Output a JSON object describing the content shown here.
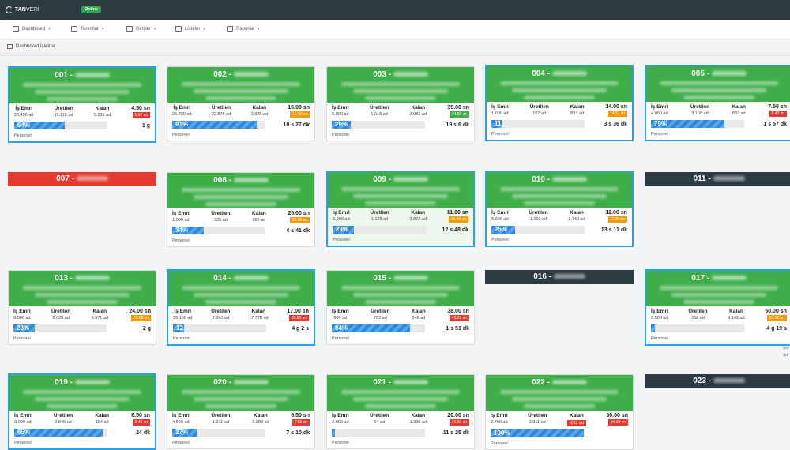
{
  "header": {
    "logo_text": "TANVERİ",
    "logo_bold": "TAN",
    "logo_light": "VERİ",
    "status": "Online"
  },
  "menu": [
    {
      "label": "Dashboard",
      "icon": "dashboard-icon"
    },
    {
      "label": "Tanımlar",
      "icon": "definitions-icon"
    },
    {
      "label": "Girişler",
      "icon": "entries-icon"
    },
    {
      "label": "Listeler",
      "icon": "lists-icon"
    },
    {
      "label": "Raporlar",
      "icon": "reports-icon"
    }
  ],
  "breadcrumb": "Dashboard İşletme",
  "labels": {
    "order": "İş Emri",
    "produced": "Üretilen",
    "remaining": "Kalan",
    "staff": "Personel"
  },
  "colors": {
    "green": "#3fae49",
    "red": "#e53a2f",
    "orange": "#f59b00",
    "dark": "#2e3a42",
    "selected": "#2aa1e3",
    "progress": "#2e86de"
  },
  "cards": [
    {
      "id": "001",
      "order": "20.450 ad",
      "produced": "11.115 ad",
      "remaining": "9.335 ad",
      "cycle": "4.50 sn",
      "badge": "5.57 sn",
      "badge_color": "red",
      "progress": 54,
      "progress_label": "54%",
      "time": "1 g",
      "selected": true
    },
    {
      "id": "002",
      "order": "25.200 ad",
      "produced": "22.875 ad",
      "remaining": "2.325 ad",
      "cycle": "15.00 sn",
      "badge": "16.19 sn",
      "badge_color": "orange",
      "progress": 91,
      "progress_label": "91%",
      "time": "10 s 27 dk"
    },
    {
      "id": "003",
      "order": "5.000 ad",
      "produced": "1.018 ad",
      "remaining": "3.982 ad",
      "cycle": "35.00 sn",
      "badge": "34.56 sn",
      "badge_color": "green",
      "progress": 20,
      "progress_label": "20%",
      "time": "19 s 6 dk"
    },
    {
      "id": "004",
      "order": "1.000 ad",
      "produced": "107 ad",
      "remaining": "893 ad",
      "cycle": "14.00 sn",
      "badge": "14.57 sn",
      "badge_color": "orange",
      "progress": 11,
      "progress_label": "11",
      "time": "3 s 36 dk",
      "selected": true
    },
    {
      "id": "005",
      "order": "4.000 ad",
      "produced": "3.168 ad",
      "remaining": "832 ad",
      "cycle": "7.50 sn",
      "badge": "8.43 sn",
      "badge_color": "red",
      "progress": 79,
      "progress_label": "79%",
      "time": "1 s 57 dk",
      "selected": true
    },
    {
      "id": "008",
      "order": "1.000 ad",
      "produced": "335 ad",
      "remaining": "665 ad",
      "cycle": "25.00 sn",
      "badge": "29.36 sn",
      "badge_color": "orange",
      "progress": 34,
      "progress_label": "34%",
      "time": "4 s 41 dk"
    },
    {
      "id": "009",
      "order": "5.000 ad",
      "produced": "1.128 ad",
      "remaining": "3.872 ad",
      "cycle": "11.00 sn",
      "badge": "11.80 sn",
      "badge_color": "orange",
      "progress": 23,
      "progress_label": "23%",
      "time": "12 s 48 dk",
      "selected": true,
      "soft": true
    },
    {
      "id": "010",
      "order": "5.000 ad",
      "produced": "1.260 ad",
      "remaining": "3.740 ad",
      "cycle": "12.00 sn",
      "badge": "12.96 sn",
      "badge_color": "orange",
      "progress": 25,
      "progress_label": "25%",
      "time": "13 s 11 dk",
      "selected": true
    },
    {
      "id": "013",
      "order": "9.000 ad",
      "produced": "2.029 ad",
      "remaining": "6.971 ad",
      "cycle": "24.00 sn",
      "badge": "25.08 sn",
      "badge_color": "orange",
      "progress": 23,
      "progress_label": "23%",
      "time": "2 g"
    },
    {
      "id": "014",
      "order": "20.160 ad",
      "produced": "2.390 ad",
      "remaining": "17.770 ad",
      "cycle": "17.00 sn",
      "badge": "20.03 sn",
      "badge_color": "red",
      "progress": 12,
      "progress_label": "12",
      "time": "4 g 2 s",
      "selected": true
    },
    {
      "id": "015",
      "order": "900 ad",
      "produced": "752 ad",
      "remaining": "148 ad",
      "cycle": "38.00 sn",
      "badge": "45.21 sn",
      "badge_color": "red",
      "progress": 84,
      "progress_label": "84%",
      "time": "1 s 51 dk"
    },
    {
      "id": "017",
      "order": "8.500 ad",
      "produced": "358 ad",
      "remaining": "8.142 ad",
      "cycle": "50.00 sn",
      "badge": "51.06 sn",
      "badge_color": "orange",
      "progress": 4,
      "progress_label": "",
      "time": "4 g 19 s",
      "selected": true
    },
    {
      "id": "019",
      "order": "3.000 ad",
      "produced": "2.846 ad",
      "remaining": "154 ad",
      "cycle": "6.50 sn",
      "badge": "9.40 sn",
      "badge_color": "red",
      "progress": 95,
      "progress_label": "95%",
      "time": "24 dk",
      "selected": true
    },
    {
      "id": "020",
      "order": "4.500 ad",
      "produced": "1.211 ad",
      "remaining": "3.289 ad",
      "cycle": "5.50 sn",
      "badge": "7.86 sn",
      "badge_color": "red",
      "progress": 27,
      "progress_label": "27%",
      "time": "7 s 10 dk"
    },
    {
      "id": "021",
      "order": "2.000 ad",
      "produced": "64 ad",
      "remaining": "1.936 ad",
      "cycle": "20.00 sn",
      "badge": "21.23 sn",
      "badge_color": "red",
      "progress": 3,
      "progress_label": "",
      "time": "11 s 25 dk"
    },
    {
      "id": "022",
      "order": "2.700 ad",
      "produced": "2.911 ad",
      "remaining": "-211 ad",
      "remaining_red": true,
      "cycle": "30.00 sn",
      "badge": "34.39 sn",
      "badge_color": "red",
      "progress": 100,
      "progress_label": "100%",
      "time": ""
    }
  ],
  "strips": [
    {
      "id": "007",
      "color": "red"
    },
    {
      "id": "011",
      "color": "dark"
    },
    {
      "id": "016",
      "color": "dark"
    },
    {
      "id": "023",
      "color": "dark"
    }
  ],
  "side_links": [
    "nul",
    "nul"
  ]
}
